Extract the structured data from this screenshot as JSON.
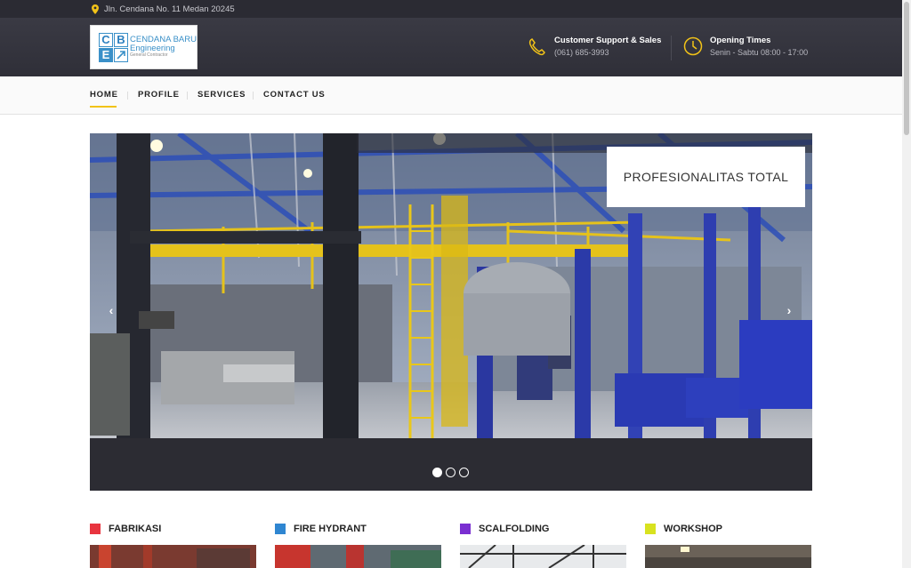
{
  "topbar": {
    "address": "Jln. Cendana No. 11 Medan 20245"
  },
  "logo": {
    "letters": [
      "C",
      "B",
      "E",
      ""
    ],
    "line1": "CENDANA BARU",
    "line2": "Engineering",
    "line3": "General Contractor"
  },
  "contacts": [
    {
      "title": "Customer Support & Sales",
      "subtitle": "(061) 685-3993",
      "icon": "phone-icon"
    },
    {
      "title": "Opening Times",
      "subtitle": "Senin - Sabtu 08:00 - 17:00",
      "icon": "clock-icon"
    }
  ],
  "nav": {
    "items": [
      "HOME",
      "PROFILE",
      "SERVICES",
      "CONTACT US"
    ],
    "active": "HOME"
  },
  "slider": {
    "caption": "PROFESIONALITAS TOTAL",
    "prev": "‹",
    "next": "›",
    "slides": 3,
    "active_slide": 1
  },
  "services": [
    {
      "label": "FABRIKASI",
      "color": "#e8343f"
    },
    {
      "label": "FIRE HYDRANT",
      "color": "#2f86d1"
    },
    {
      "label": "SCALFOLDING",
      "color": "#7a2fd1"
    },
    {
      "label": "WORKSHOP",
      "color": "#d8e21f"
    }
  ],
  "colors": {
    "accent": "#f2c318",
    "header_bg": "#33333c",
    "topbar_bg": "#2b2b33"
  }
}
